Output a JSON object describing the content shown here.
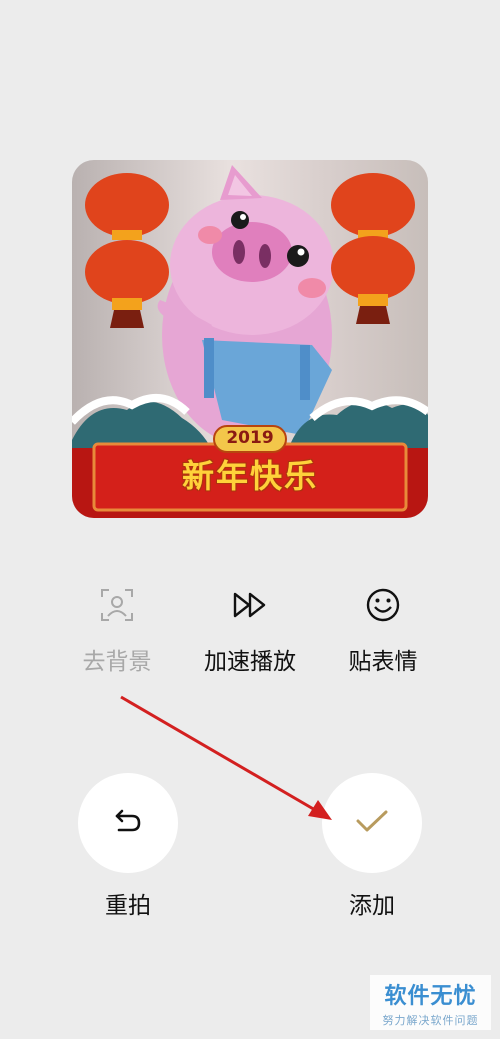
{
  "preview": {
    "year_text": "2019",
    "banner_text": "新年快乐"
  },
  "tools": [
    {
      "label": "去背景",
      "icon": "portrait-frame-icon",
      "enabled": false
    },
    {
      "label": "加速播放",
      "icon": "fast-forward-icon",
      "enabled": true
    },
    {
      "label": "贴表情",
      "icon": "smiley-icon",
      "enabled": true
    }
  ],
  "actions": {
    "retake_label": "重拍",
    "retake_icon": "undo-arrow-icon",
    "add_label": "添加",
    "add_icon": "checkmark-icon"
  },
  "colors": {
    "background": "#ececec",
    "checkmark": "#b89b5e",
    "annotation_arrow": "#d32020",
    "banner_red": "#d4201a",
    "banner_text": "#ffd23a"
  },
  "watermark": {
    "title": "软件无忧",
    "subtitle": "努力解决软件问题"
  }
}
